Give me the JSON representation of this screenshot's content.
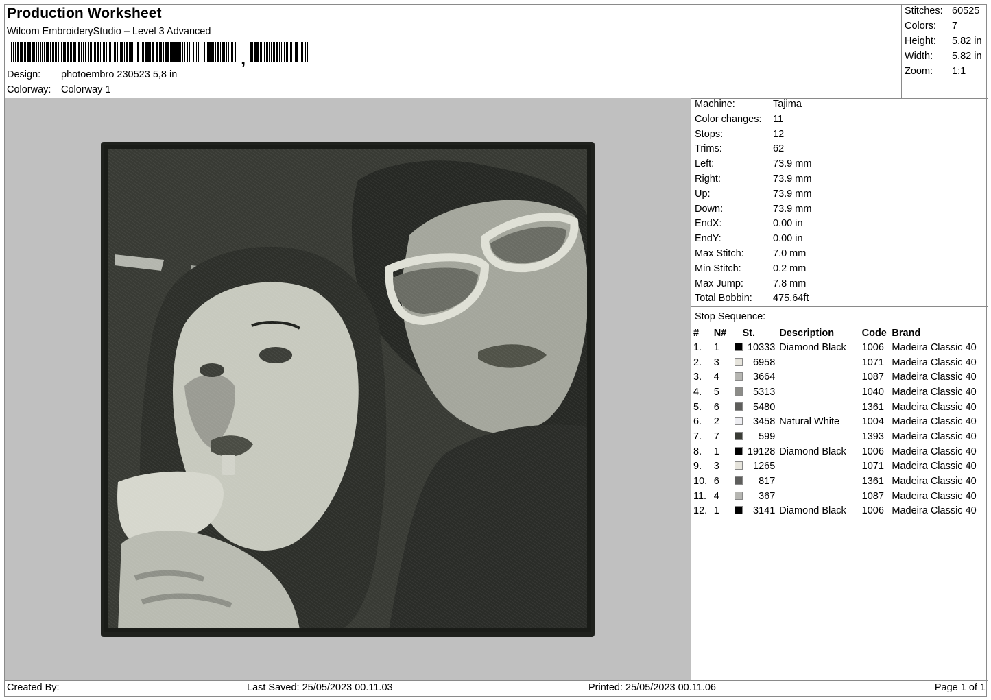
{
  "header": {
    "title": "Production Worksheet",
    "subtitle": "Wilcom EmbroideryStudio – Level 3 Advanced",
    "design_label": "Design:",
    "design_value": "photoembro 230523 5,8 in",
    "colorway_label": "Colorway:",
    "colorway_value": "Colorway 1"
  },
  "stats": [
    {
      "label": "Stitches:",
      "value": "60525"
    },
    {
      "label": "Colors:",
      "value": "7"
    },
    {
      "label": "Height:",
      "value": "5.82 in"
    },
    {
      "label": "Width:",
      "value": "5.82 in"
    },
    {
      "label": "Zoom:",
      "value": "1:1"
    }
  ],
  "machine": [
    {
      "label": "Machine:",
      "value": "Tajima"
    },
    {
      "label": "Color changes:",
      "value": "11"
    },
    {
      "label": "Stops:",
      "value": "12"
    },
    {
      "label": "Trims:",
      "value": "62"
    },
    {
      "label": "Left:",
      "value": "73.9 mm"
    },
    {
      "label": "Right:",
      "value": "73.9 mm"
    },
    {
      "label": "Up:",
      "value": "73.9 mm"
    },
    {
      "label": "Down:",
      "value": "73.9 mm"
    },
    {
      "label": "EndX:",
      "value": "0.00 in"
    },
    {
      "label": "EndY:",
      "value": "0.00 in"
    },
    {
      "label": "Max Stitch:",
      "value": "7.0 mm"
    },
    {
      "label": "Min Stitch:",
      "value": "0.2 mm"
    },
    {
      "label": "Max Jump:",
      "value": "7.8 mm"
    },
    {
      "label": "Total Bobbin:",
      "value": "475.64ft"
    }
  ],
  "stop_sequence": {
    "title": "Stop Sequence:",
    "headers": {
      "idx": "#",
      "n": "N#",
      "st": "St.",
      "desc": "Description",
      "code": "Code",
      "brand": "Brand"
    },
    "rows": [
      {
        "idx": "1.",
        "n": "1",
        "color": "#000000",
        "st": "10333",
        "desc": "Diamond Black",
        "code": "1006",
        "brand": "Madeira Classic 40"
      },
      {
        "idx": "2.",
        "n": "3",
        "color": "#e6e4dc",
        "st": "6958",
        "desc": "",
        "code": "1071",
        "brand": "Madeira Classic 40"
      },
      {
        "idx": "3.",
        "n": "4",
        "color": "#b6b6b2",
        "st": "3664",
        "desc": "",
        "code": "1087",
        "brand": "Madeira Classic 40"
      },
      {
        "idx": "4.",
        "n": "5",
        "color": "#8c8c88",
        "st": "5313",
        "desc": "",
        "code": "1040",
        "brand": "Madeira Classic 40"
      },
      {
        "idx": "5.",
        "n": "6",
        "color": "#5e5e5c",
        "st": "5480",
        "desc": "",
        "code": "1361",
        "brand": "Madeira Classic 40"
      },
      {
        "idx": "6.",
        "n": "2",
        "color": "#eeeef2",
        "st": "3458",
        "desc": "Natural White",
        "code": "1004",
        "brand": "Madeira Classic 40"
      },
      {
        "idx": "7.",
        "n": "7",
        "color": "#3a3c36",
        "st": "599",
        "desc": "",
        "code": "1393",
        "brand": "Madeira Classic 40"
      },
      {
        "idx": "8.",
        "n": "1",
        "color": "#000000",
        "st": "19128",
        "desc": "Diamond Black",
        "code": "1006",
        "brand": "Madeira Classic 40"
      },
      {
        "idx": "9.",
        "n": "3",
        "color": "#e6e4dc",
        "st": "1265",
        "desc": "",
        "code": "1071",
        "brand": "Madeira Classic 40"
      },
      {
        "idx": "10.",
        "n": "6",
        "color": "#5e5e5c",
        "st": "817",
        "desc": "",
        "code": "1361",
        "brand": "Madeira Classic 40"
      },
      {
        "idx": "11.",
        "n": "4",
        "color": "#b6b6b2",
        "st": "367",
        "desc": "",
        "code": "1087",
        "brand": "Madeira Classic 40"
      },
      {
        "idx": "12.",
        "n": "1",
        "color": "#000000",
        "st": "3141",
        "desc": "Diamond Black",
        "code": "1006",
        "brand": "Madeira Classic 40"
      }
    ]
  },
  "footer": {
    "created_by": "Created By:",
    "last_saved": "Last Saved: 25/05/2023 00.11.03",
    "printed": "Printed: 25/05/2023 00.11.06",
    "page": "Page 1 of 1"
  },
  "barcode_suffix": ","
}
